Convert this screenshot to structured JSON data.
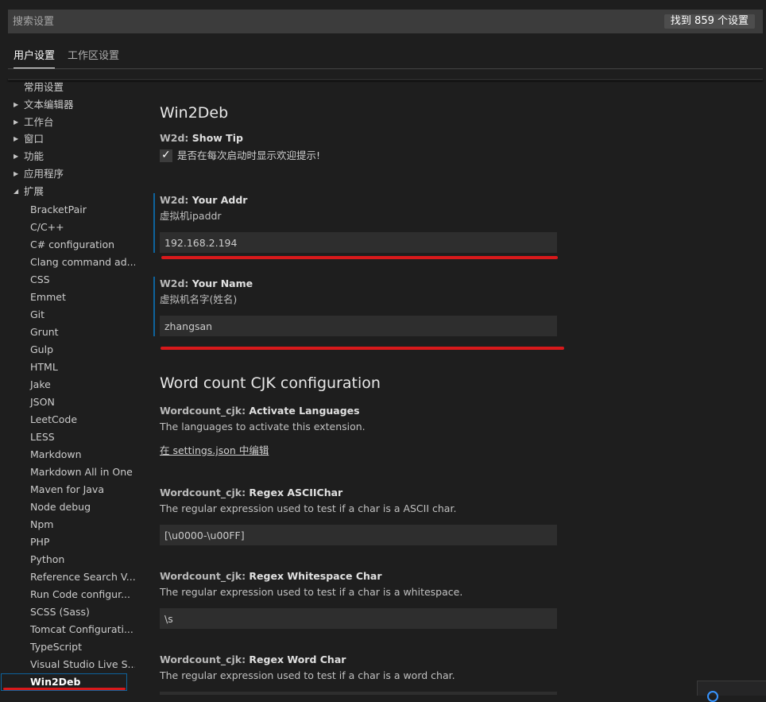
{
  "search": {
    "placeholder": "搜索设置",
    "result_count": "找到 859 个设置"
  },
  "tabs": [
    {
      "label": "用户设置",
      "active": true
    },
    {
      "label": "工作区设置",
      "active": false
    }
  ],
  "toc": {
    "items": [
      {
        "label": "常用设置",
        "twisty": ""
      },
      {
        "label": "文本编辑器",
        "twisty": "▶"
      },
      {
        "label": "工作台",
        "twisty": "▶"
      },
      {
        "label": "窗口",
        "twisty": "▶"
      },
      {
        "label": "功能",
        "twisty": "▶"
      },
      {
        "label": "应用程序",
        "twisty": "▶"
      },
      {
        "label": "扩展",
        "twisty": "◢"
      }
    ],
    "extensions": [
      "BracketPair",
      "C/C++",
      "C# configuration",
      "Clang command ad...",
      "CSS",
      "Emmet",
      "Git",
      "Grunt",
      "Gulp",
      "HTML",
      "Jake",
      "JSON",
      "LeetCode",
      "LESS",
      "Markdown",
      "Markdown All in One",
      "Maven for Java",
      "Node debug",
      "Npm",
      "PHP",
      "Python",
      "Reference Search V...",
      "Run Code configur...",
      "SCSS (Sass)",
      "Tomcat Configurati...",
      "TypeScript",
      "Visual Studio Live S...",
      "Win2Deb"
    ],
    "selected": "Win2Deb"
  },
  "sections": {
    "win2deb": {
      "title": "Win2Deb",
      "show_tip": {
        "category": "W2d: ",
        "name": "Show Tip",
        "checkbox_label": "是否在每次启动时显示欢迎提示!",
        "checked": true,
        "check_glyph": "✓"
      },
      "your_addr": {
        "category": "W2d: ",
        "name": "Your Addr",
        "description": "虚拟机ipaddr",
        "value": "192.168.2.194"
      },
      "your_name": {
        "category": "W2d: ",
        "name": "Your Name",
        "description": "虚拟机名字(姓名)",
        "value": "zhangsan"
      }
    },
    "wordcount": {
      "title": "Word count CJK configuration",
      "activate_languages": {
        "category": "Wordcount_cjk: ",
        "name": "Activate Languages",
        "description": "The languages to activate this extension.",
        "link": "在 settings.json 中编辑"
      },
      "regex_ascii": {
        "category": "Wordcount_cjk: ",
        "name": "Regex ASCIIChar",
        "description": "The regular expression used to test if a char is a ASCII char.",
        "value": "[\\u0000-\\u00FF]"
      },
      "regex_whitespace": {
        "category": "Wordcount_cjk: ",
        "name": "Regex Whitespace Char",
        "description": "The regular expression used to test if a char is a whitespace.",
        "value": "\\s"
      },
      "regex_word": {
        "category": "Wordcount_cjk: ",
        "name": "Regex Word Char",
        "description": "The regular expression used to test if a char is a word char."
      }
    }
  },
  "colors": {
    "background": "#1e1e1e",
    "modified_indicator": "#0e639c",
    "annotation_red": "#d8191b",
    "input_background": "#2e2e2e"
  }
}
